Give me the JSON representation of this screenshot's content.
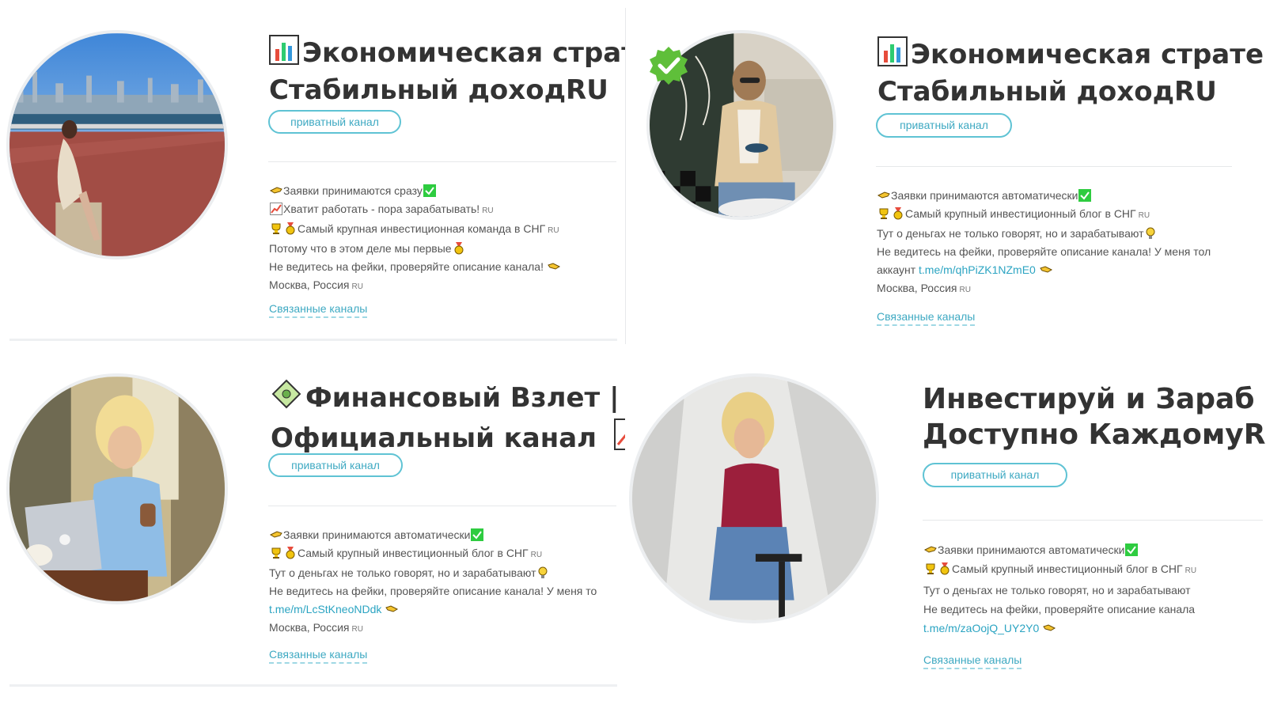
{
  "cards": [
    {
      "title_line1": "Экономическая страте",
      "title_line2": "Стабильный доходRU",
      "badge": "приватный канал",
      "lines": [
        "Заявки принимаются сразу",
        "Хватит работать - пора зарабатывать!",
        "Самый крупная инвестиционная команда в СНГ",
        "Потому что в этом деле мы первые",
        "Не ведитесь на фейки, проверяйте описание канала!",
        "Москва, Россия"
      ],
      "ru_tag": "RU",
      "related": "Связанные каналы"
    },
    {
      "title_line1": "Экономическая страте",
      "title_line2": "Стабильный доходRU",
      "badge": "приватный канал",
      "lines": [
        "Заявки принимаются автоматически",
        "Самый крупный инвестиционный блог в СНГ",
        "Тут о деньгах не только говорят, но и зарабатывают",
        "Не ведитесь на фейки, проверяйте описание канала! У меня тол",
        "аккаунт",
        "Москва, Россия"
      ],
      "link": "t.me/m/qhPiZK1NZmE0",
      "ru_tag": "RU",
      "related": "Связанные каналы"
    },
    {
      "title_line1": "Финансовый Взлет |",
      "title_line2": "Официальный канал",
      "badge": "приватный канал",
      "lines": [
        "Заявки принимаются автоматически",
        "Самый крупный инвестиционный блог в СНГ",
        "Тут о деньгах не только говорят, но и зарабатывают",
        "Не ведитесь на фейки, проверяйте описание канала! У меня то",
        "Москва, Россия"
      ],
      "link": "t.me/m/LcStKneoNDdk",
      "ru_tag": "RU",
      "related": "Связанные каналы"
    },
    {
      "title_line1": "Инвестируй и Зараб",
      "title_line2": "Доступно КаждомуR",
      "badge": "приватный канал",
      "lines": [
        "Заявки принимаются автоматически",
        "Самый крупный инвестиционный блог в СНГ",
        "Тут о деньгах не только говорят, но и зарабатывают",
        "Не ведитесь на фейки, проверяйте описание канала"
      ],
      "link": "t.me/m/zaOojQ_UY2Y0",
      "ru_tag": "RU",
      "related": "Связанные каналы"
    }
  ],
  "colors": {
    "accent": "#3ea9c2",
    "badge_border": "#5fc3d4",
    "verified": "#5fbf3a",
    "check_green": "#2ecc40"
  }
}
